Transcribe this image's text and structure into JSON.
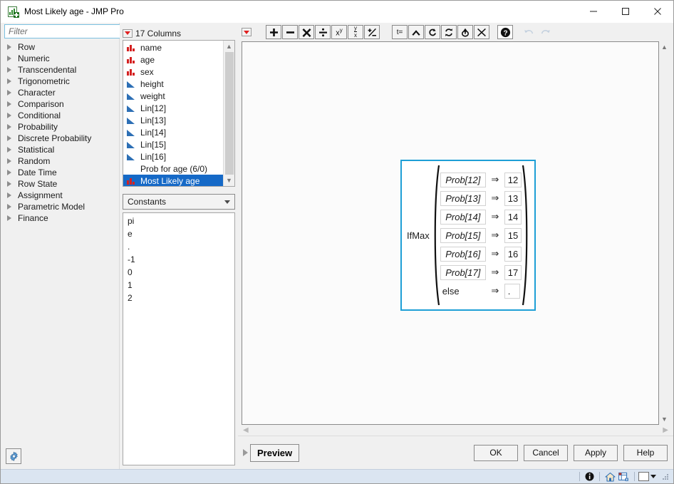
{
  "window": {
    "title": "Most Likely age - JMP Pro",
    "icon": "jmp-formula-icon",
    "controls": {
      "minimize": "minimize-icon",
      "maximize": "maximize-icon",
      "close": "close-icon"
    }
  },
  "filter": {
    "placeholder": "Filter",
    "value": "",
    "search_icon": "search-icon",
    "dropdown_icon": "chevron-down-icon"
  },
  "functions": {
    "items": [
      {
        "label": "Row"
      },
      {
        "label": "Numeric"
      },
      {
        "label": "Transcendental"
      },
      {
        "label": "Trigonometric"
      },
      {
        "label": "Character"
      },
      {
        "label": "Comparison"
      },
      {
        "label": "Conditional"
      },
      {
        "label": "Probability"
      },
      {
        "label": "Discrete Probability"
      },
      {
        "label": "Statistical"
      },
      {
        "label": "Random"
      },
      {
        "label": "Date Time"
      },
      {
        "label": "Row State"
      },
      {
        "label": "Assignment"
      },
      {
        "label": "Parametric Model"
      },
      {
        "label": "Finance"
      }
    ],
    "settings_button": "gear-icon"
  },
  "columns": {
    "header": "17 Columns",
    "menu_icon": "red-triangle-menu-icon",
    "items": [
      {
        "label": "name",
        "type": "nominal"
      },
      {
        "label": "age",
        "type": "nominal"
      },
      {
        "label": "sex",
        "type": "nominal"
      },
      {
        "label": "height",
        "type": "continuous"
      },
      {
        "label": "weight",
        "type": "continuous"
      },
      {
        "label": "Lin[12]",
        "type": "continuous"
      },
      {
        "label": "Lin[13]",
        "type": "continuous"
      },
      {
        "label": "Lin[14]",
        "type": "continuous"
      },
      {
        "label": "Lin[15]",
        "type": "continuous"
      },
      {
        "label": "Lin[16]",
        "type": "continuous"
      },
      {
        "label": "Prob for age (6/0)",
        "type": "group"
      },
      {
        "label": "Most Likely age",
        "type": "nominal",
        "selected": true
      }
    ]
  },
  "constants": {
    "selected": "Constants",
    "items": [
      "pi",
      "e",
      ".",
      "-1",
      "0",
      "1",
      "2"
    ]
  },
  "toolbar": {
    "menu_icon": "red-triangle-menu-icon",
    "buttons": [
      {
        "name": "add-button",
        "glyph": "✚",
        "title": "Add"
      },
      {
        "name": "subtract-button",
        "glyph": "➖",
        "title": "Subtract"
      },
      {
        "name": "multiply-button",
        "glyph": "✖",
        "title": "Multiply"
      },
      {
        "name": "divide-button",
        "glyph": "÷",
        "title": "Divide"
      },
      {
        "name": "exponent-button",
        "glyph": "xʸ",
        "title": "Exponent"
      },
      {
        "name": "root-button",
        "glyph": "y/x",
        "title": "Root"
      },
      {
        "name": "sign-button",
        "glyph": "±",
        "title": "Change sign"
      }
    ],
    "edit_buttons": [
      {
        "name": "local-variable-button",
        "glyph": "t=",
        "title": "Local variable"
      },
      {
        "name": "insert-above-button",
        "glyph": "▲",
        "title": "Insert above"
      },
      {
        "name": "peel-button",
        "glyph": "⟲",
        "title": "Peel"
      },
      {
        "name": "swap-button",
        "glyph": "↻",
        "title": "Swap"
      },
      {
        "name": "move-button",
        "glyph": "⇅",
        "title": "Move"
      },
      {
        "name": "delete-button",
        "glyph": "✕",
        "title": "Delete"
      }
    ],
    "help_button": {
      "name": "help-button",
      "glyph": "?"
    },
    "undo_button": {
      "name": "undo-button",
      "glyph": "↶",
      "disabled": true
    },
    "redo_button": {
      "name": "redo-button",
      "glyph": "↷",
      "disabled": true
    }
  },
  "formula": {
    "function_name": "IfMax",
    "rows": [
      {
        "condition": "Prob[12]",
        "arrow": "⇒",
        "result": "12"
      },
      {
        "condition": "Prob[13]",
        "arrow": "⇒",
        "result": "13"
      },
      {
        "condition": "Prob[14]",
        "arrow": "⇒",
        "result": "14"
      },
      {
        "condition": "Prob[15]",
        "arrow": "⇒",
        "result": "15"
      },
      {
        "condition": "Prob[16]",
        "arrow": "⇒",
        "result": "16"
      },
      {
        "condition": "Prob[17]",
        "arrow": "⇒",
        "result": "17"
      }
    ],
    "else_row": {
      "condition": "else",
      "arrow": "⇒",
      "result": "."
    },
    "selection_color": "#1e9fd6"
  },
  "actions": {
    "preview_label": "Preview",
    "ok_label": "OK",
    "cancel_label": "Cancel",
    "apply_label": "Apply",
    "help_label": "Help"
  },
  "statusbar": {
    "info_icon": "info-icon",
    "home_icon": "home-icon",
    "table_icon": "data-table-icon",
    "color_swatch": "#ffffff",
    "color_dropdown_icon": "chevron-down-icon",
    "resize_grip": "resize-grip-icon"
  },
  "theme": {
    "accent": "#1e9fd6",
    "selection": "#1569c7",
    "nominal_icon": "#d42020",
    "continuous_icon": "#2d6fb5",
    "statusbar_bg": "#dbe5f1"
  }
}
